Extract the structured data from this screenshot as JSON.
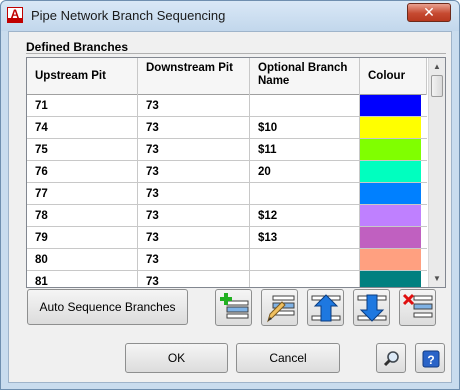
{
  "window": {
    "title": "Pipe Network Branch Sequencing",
    "app_icon_letter": "A",
    "close_glyph": "✕"
  },
  "group": {
    "label": "Defined Branches"
  },
  "table": {
    "headers": {
      "upstream": "Upstream Pit",
      "downstream": "Downstream Pit",
      "optional": "Optional Branch Name",
      "colour": "Colour"
    },
    "rows": [
      {
        "upstream": "71",
        "downstream": "73",
        "optional": "",
        "colour": "#0000ff"
      },
      {
        "upstream": "74",
        "downstream": "73",
        "optional": "$10",
        "colour": "#ffff00"
      },
      {
        "upstream": "75",
        "downstream": "73",
        "optional": "$11",
        "colour": "#80ff00"
      },
      {
        "upstream": "76",
        "downstream": "73",
        "optional": "20",
        "colour": "#00ffbf"
      },
      {
        "upstream": "77",
        "downstream": "73",
        "optional": "",
        "colour": "#0080ff"
      },
      {
        "upstream": "78",
        "downstream": "73",
        "optional": "$12",
        "colour": "#bf80ff"
      },
      {
        "upstream": "79",
        "downstream": "73",
        "optional": "$13",
        "colour": "#c060c0"
      },
      {
        "upstream": "80",
        "downstream": "73",
        "optional": "",
        "colour": "#ffa080"
      },
      {
        "upstream": "81",
        "downstream": "73",
        "optional": "",
        "colour": "#008080"
      }
    ]
  },
  "buttons": {
    "auto_sequence": "Auto Sequence Branches",
    "ok": "OK",
    "cancel": "Cancel"
  },
  "icons": {
    "add_branch": "add-branch-icon",
    "edit_branch": "edit-branch-icon",
    "move_up": "move-up-icon",
    "move_down": "move-down-icon",
    "delete_branch": "delete-branch-icon",
    "zoom": "zoom-icon",
    "help": "help-icon"
  },
  "scrollbar": {
    "up_glyph": "▲",
    "down_glyph": "▼"
  }
}
